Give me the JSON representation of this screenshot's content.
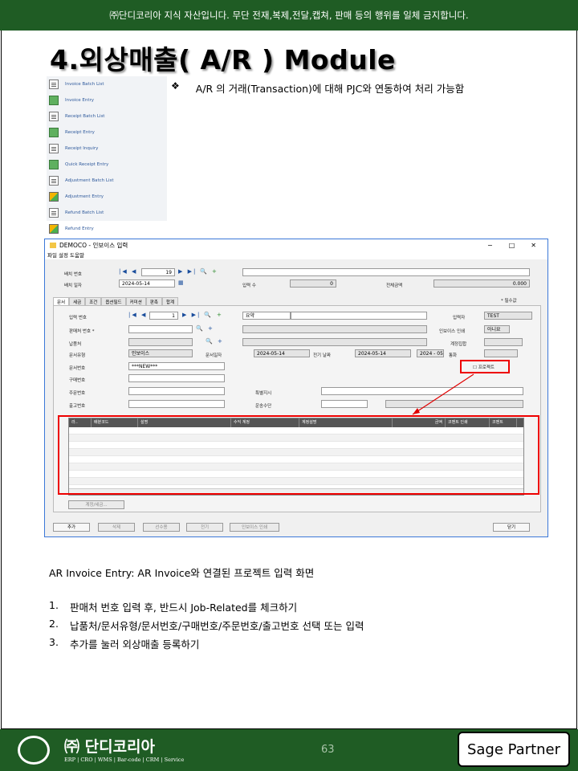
{
  "banner": "㈜단디코리아 지식 자산입니다. 무단 전재,복제,전달,캡쳐, 판매 등의 행위를 일체 금지합니다.",
  "title": "4.외상매출( A/R ) Module",
  "menu_items": [
    {
      "label": "Invoice Batch List",
      "icon": "batch-list-icon"
    },
    {
      "label": "Invoice Entry",
      "icon": "entry-icon"
    },
    {
      "label": "Receipt Batch List",
      "icon": "batch-list-icon"
    },
    {
      "label": "Receipt Entry",
      "icon": "receipt-icon"
    },
    {
      "label": "Receipt Inquiry",
      "icon": "inquiry-icon"
    },
    {
      "label": "Quick Receipt Entry",
      "icon": "receipt-icon"
    },
    {
      "label": "Adjustment Batch List",
      "icon": "batch-list-icon"
    },
    {
      "label": "Adjustment Entry",
      "icon": "adjust-icon"
    },
    {
      "label": "Refund Batch List",
      "icon": "batch-list-icon"
    },
    {
      "label": "Refund Entry",
      "icon": "refund-icon"
    }
  ],
  "bullet": {
    "symbol": "❖",
    "text": "A/R 의 거래(Transaction)에 대해 PJC와 연동하여 처리 가능함"
  },
  "window": {
    "title": "DEMOCO - 인보이스 입력",
    "menu": "파일 설정 도움말",
    "batch_no_label": "배치 번호",
    "batch_no": "19",
    "batch_date_label": "배치 일자",
    "batch_date": "2024-05-14",
    "entry_count_label": "입력 수",
    "entry_count": "0",
    "total_label": "전체금액",
    "total": "0.000",
    "tabs": [
      "문서",
      "세금",
      "조건",
      "옵션필드",
      "커미션",
      "판촉",
      "합계"
    ],
    "required_note": "* 필수값",
    "entry_no_label": "입력 번호",
    "entry_no": "1",
    "summary": "요약",
    "entered_by_label": "입력자",
    "entered_by": "TEST",
    "customer_label": "판매처 번호 *",
    "invoice_print_label": "인보이스 인쇄",
    "invoice_print": "아니요",
    "ship_to_label": "납품처",
    "account_set_label": "계정집합",
    "doc_type_label": "문서유형",
    "doc_type": "인보이스",
    "doc_date_label": "문서일자",
    "doc_date": "2024-05-14",
    "post_date_label": "전기 날짜",
    "post_date": "2024-05-14",
    "period": "2024 - 05",
    "currency_label": "통화",
    "doc_no_label": "문서번호",
    "doc_no": "***NEW***",
    "job_related": "프로젝트",
    "po_no_label": "구매번호",
    "order_no_label": "주문번호",
    "special_label": "특별지시",
    "shipment_no_label": "출고번호",
    "ship_via_label": "운송수단",
    "grid_headers": [
      "라..",
      "배분코드",
      "설명",
      "수익 계정",
      "계정설명",
      "금액",
      "코멘트 인쇄",
      "코멘트"
    ],
    "tax_button": "계정/세금...",
    "buttons": [
      "추가",
      "삭제",
      "선수용",
      "전기",
      "인보이스 인쇄",
      "닫기"
    ]
  },
  "caption": "AR Invoice Entry:  AR Invoice와 연결된 프로젝트 입력 화면",
  "steps": [
    {
      "n": "1.",
      "text": "판매처 번호 입력 후, 반드시 Job-Related를 체크하기"
    },
    {
      "n": "2.",
      "text": "납품처/문서유형/문서번호/구매번호/주문번호/출고번호  선택 또는 입력"
    },
    {
      "n": "3.",
      "text": "추가를 눌러 외상매출 등록하기"
    }
  ],
  "footer": {
    "brand": "㈜ 단디코리아",
    "tagline": "ERP | CRO | WMS | Bar-code | CRM | Service",
    "page_number": "63",
    "partner": "Sage Partner"
  },
  "colors": {
    "brand_green": "#1f5c24",
    "highlight_red": "#e00000"
  }
}
